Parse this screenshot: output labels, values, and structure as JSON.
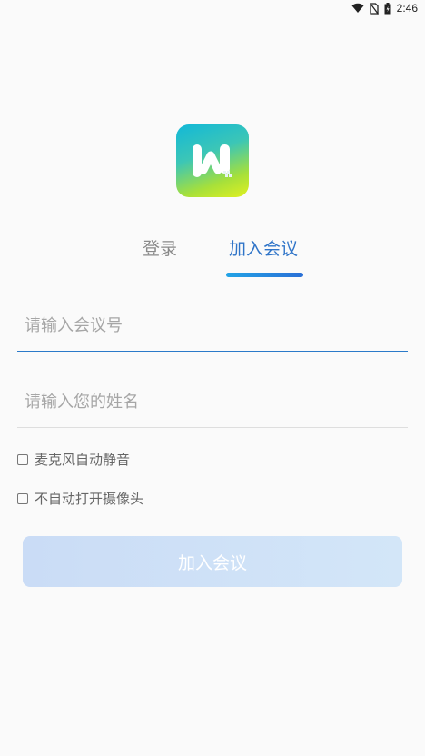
{
  "status_bar": {
    "time": "2:46",
    "icons": [
      "wifi-icon",
      "no-sim-icon",
      "battery-icon"
    ]
  },
  "app": {
    "logo_icon": "meeting-app-logo-icon"
  },
  "tabs": [
    {
      "label": "登录",
      "active": false
    },
    {
      "label": "加入会议",
      "active": true
    }
  ],
  "form": {
    "meeting_id": {
      "value": "",
      "placeholder": "请输入会议号"
    },
    "name": {
      "value": "",
      "placeholder": "请输入您的姓名"
    },
    "options": [
      {
        "label": "麦克风自动静音",
        "checked": false
      },
      {
        "label": "不自动打开摄像头",
        "checked": false
      }
    ],
    "submit_label": "加入会议"
  },
  "colors": {
    "accent": "#2f74c8",
    "inactive_tab": "#8a8a8a",
    "button_disabled": "#cadcf6"
  }
}
